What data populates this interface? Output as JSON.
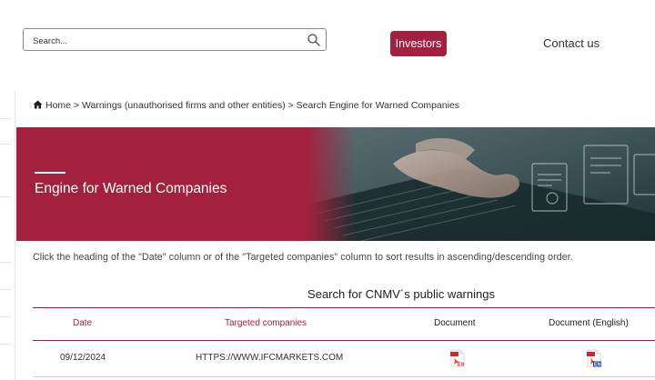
{
  "header": {
    "search": {
      "placeholder": "Search..."
    },
    "investors_label": "Investors",
    "contact_label": "Contact us"
  },
  "breadcrumb": {
    "text": "Home > Warnings (unauthorised firms and other entities) > Search Engine for Warned Companies"
  },
  "hero": {
    "title": "Engine for Warned Companies"
  },
  "instructions": "Click the heading of the \"Date\" column or of the \"Targeted companies\" column to sort results in ascending/descending order.",
  "table": {
    "title": "Search for CNMV´s public warnings",
    "columns": [
      "Date",
      "Targeted companies",
      "Document",
      "Document (English)"
    ],
    "rows": [
      {
        "date": "09/12/2024",
        "company": "HTTPS://WWW.IFCMARKETS.COM",
        "doc_badge": "ES",
        "doc_en_badge": "EN"
      }
    ]
  },
  "colors": {
    "brand": "#a3213f",
    "text": "#333333"
  },
  "icons": [
    "search-icon",
    "home-icon",
    "pdf-es-icon",
    "pdf-en-icon"
  ]
}
